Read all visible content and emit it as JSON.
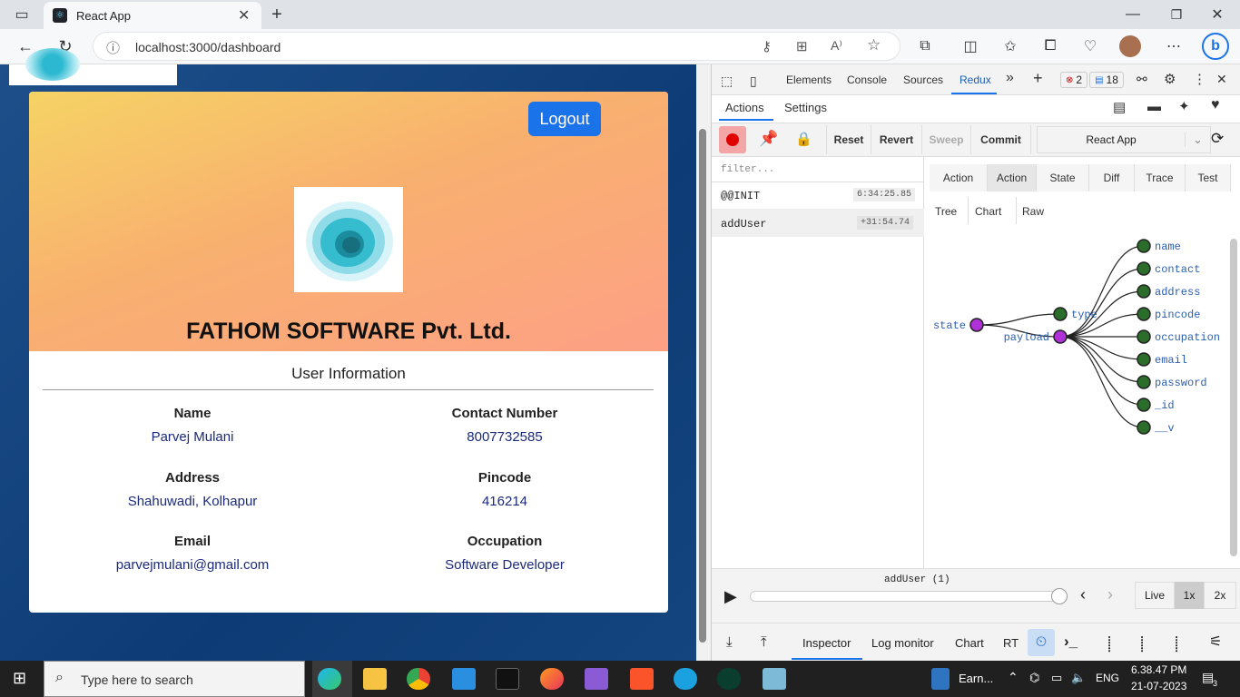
{
  "browser": {
    "tab_title": "React App",
    "url": "localhost:3000/dashboard"
  },
  "dashboard": {
    "logout_label": "Logout",
    "company_name": "FATHOM SOFTWARE Pvt. Ltd.",
    "section_title": "User Information",
    "fields": [
      {
        "label": "Name",
        "value": "Parvej Mulani"
      },
      {
        "label": "Contact Number",
        "value": "8007732585"
      },
      {
        "label": "Address",
        "value": "Shahuwadi, Kolhapur"
      },
      {
        "label": "Pincode",
        "value": "416214"
      },
      {
        "label": "Email",
        "value": "parvejmulani@gmail.com"
      },
      {
        "label": "Occupation",
        "value": "Software Developer"
      }
    ]
  },
  "devtools": {
    "tabs": [
      "Elements",
      "Console",
      "Sources",
      "Redux"
    ],
    "error_count": "2",
    "message_count": "18",
    "redux": {
      "top_tabs": [
        "Actions",
        "Settings"
      ],
      "toolbar": [
        "Reset",
        "Revert",
        "Sweep",
        "Commit"
      ],
      "instance": "React App",
      "filter_placeholder": "filter...",
      "actions": [
        {
          "name": "@@INIT",
          "time": "6:34:25.85"
        },
        {
          "name": "addUser",
          "time": "+31:54.74"
        }
      ],
      "inspector_tabs": [
        "Action",
        "Action",
        "State",
        "Diff",
        "Trace",
        "Test"
      ],
      "view_tabs": [
        "Tree",
        "Chart",
        "Raw"
      ],
      "tree": {
        "root": "state",
        "children": [
          "type",
          "payload"
        ],
        "payload_children": [
          "name",
          "contact",
          "address",
          "pincode",
          "occupation",
          "email",
          "password",
          "_id",
          "__v"
        ]
      },
      "slider_label": "addUser (1)",
      "speed_options": [
        "Live",
        "1x",
        "2x"
      ],
      "bottom_tabs": [
        "Inspector",
        "Log monitor",
        "Chart",
        "RT"
      ]
    }
  },
  "taskbar": {
    "search_placeholder": "Type here to search",
    "running_app": "Earn...",
    "language": "ENG",
    "time": "6.38.47 PM",
    "date": "21-07-2023",
    "notification_count": "3"
  }
}
